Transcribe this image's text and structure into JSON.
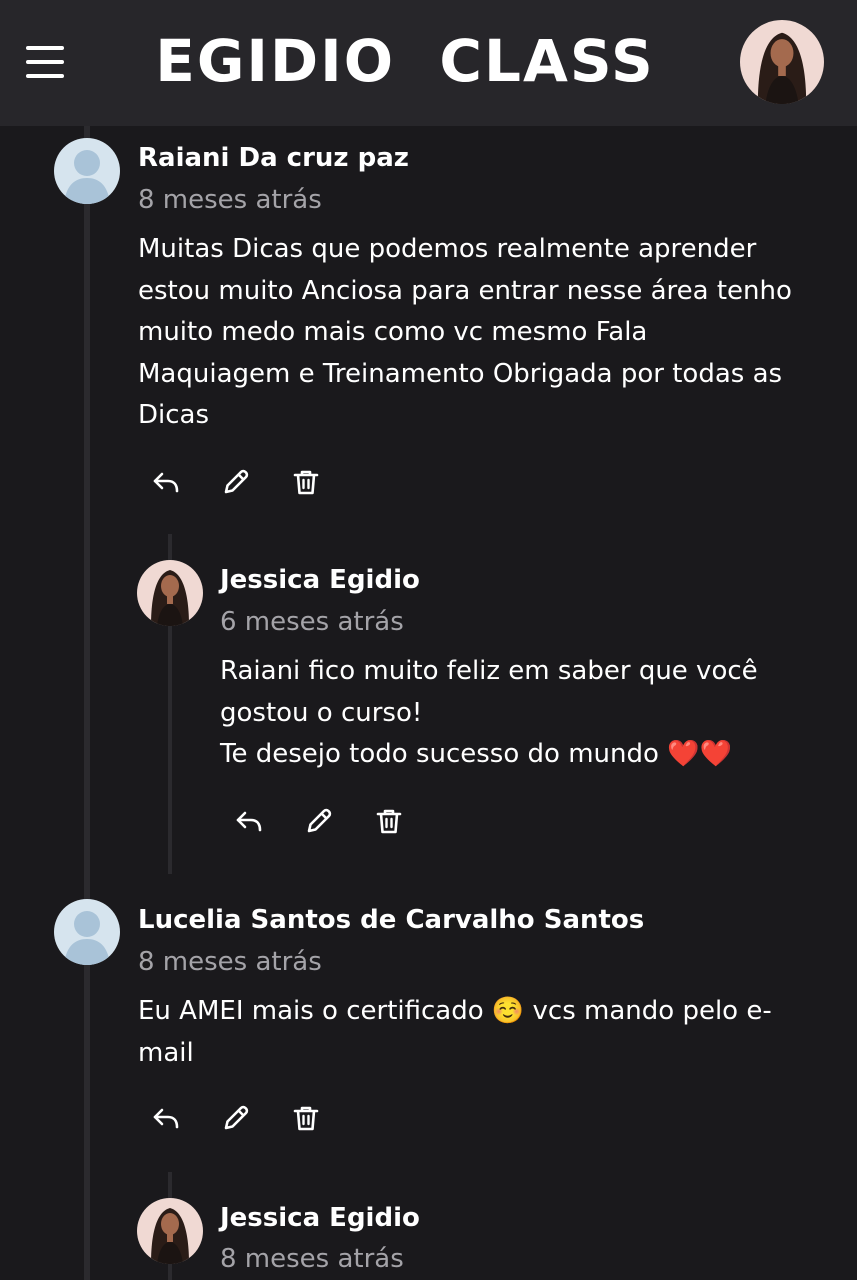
{
  "app": {
    "brand": "EGIDIO  CLASS"
  },
  "icons": {
    "menu": "hamburger-menu-icon",
    "reply": "reply-arrow-icon",
    "edit": "pencil-icon",
    "delete": "trash-icon",
    "user_placeholder": "user-silhouette-icon"
  },
  "colors": {
    "background": "#1a191c",
    "header": "#27262a",
    "muted_text": "#a4a3a8",
    "avatar_placeholder": "#d6e4ee"
  },
  "comments": [
    {
      "author": "Raiani Da cruz paz",
      "time": "8 meses atrás",
      "body": "Muitas Dicas que podemos realmente aprender\nestou muito Anciosa para entrar nesse área tenho\nmuito medo mais como vc mesmo Fala\nMaquiagem e Treinamento Obrigada por todas as\nDicas",
      "avatar": "placeholder",
      "replies": [
        {
          "author": "Jessica Egidio",
          "time": "6 meses atrás",
          "body": "Raiani fico muito feliz em saber que você\ngostou o curso!\nTe desejo todo sucesso do mundo ❤️❤️",
          "avatar": "photo"
        }
      ]
    },
    {
      "author": "Lucelia Santos de Carvalho Santos",
      "time": "8 meses atrás",
      "body": "Eu AMEI mais o certificado ☺️ vcs mando pelo e-\nmail",
      "avatar": "placeholder",
      "replies": [
        {
          "author": "Jessica Egidio",
          "time": "8 meses atrás",
          "body": "",
          "avatar": "photo"
        }
      ]
    }
  ]
}
